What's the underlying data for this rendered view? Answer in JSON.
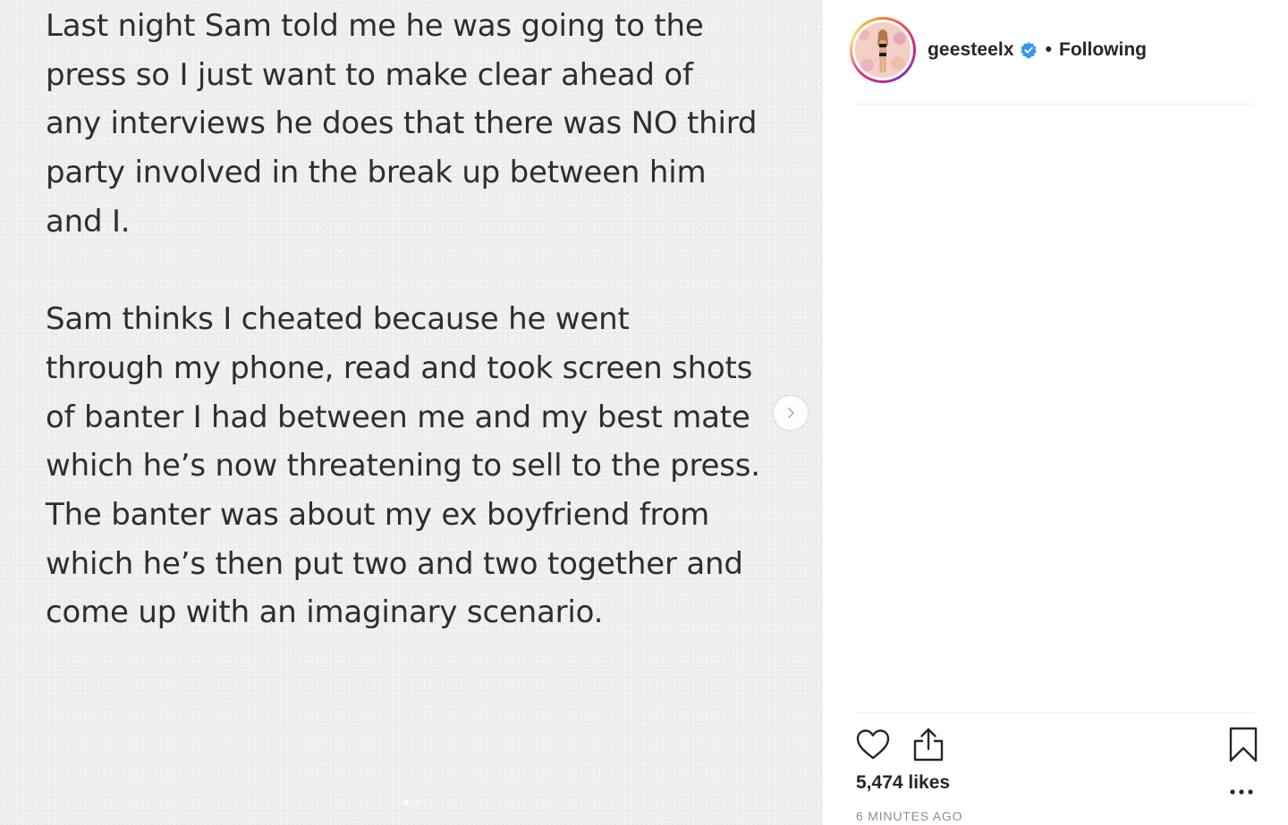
{
  "post": {
    "paragraphs": [
      [
        "Last night Sam told me he was going to the",
        "press so I just want to make clear ahead of",
        "any interviews he does that there was NO third",
        "party involved in the break up between him",
        "and I."
      ],
      [
        "Sam thinks I cheated because he went",
        "through my phone, read and took screen shots",
        "of banter I had between me and my best mate",
        "which he’s now threatening to sell to the press.",
        "The banter was about my ex boyfriend from",
        "which he’s then put two and two together and",
        "come up with an imaginary scenario."
      ]
    ]
  },
  "carousel": {
    "next_icon": "chevron-right-icon",
    "page_count": 2,
    "active_index": 0
  },
  "header": {
    "username": "geesteelx",
    "verified_icon": "verified-badge-icon",
    "separator": "•",
    "follow_status": "Following"
  },
  "actions": {
    "like_icon": "heart-outline-icon",
    "share_icon": "share-upload-icon",
    "save_icon": "bookmark-icon",
    "more_icon": "ellipsis-icon"
  },
  "stats": {
    "likes_text": "5,474 likes",
    "timestamp": "6 MINUTES AGO"
  },
  "colors": {
    "text": "#262626",
    "muted": "#8e8e8e",
    "verified": "#3897f0",
    "media_bg": "#efefef",
    "post_text": "#2e2e2e"
  }
}
